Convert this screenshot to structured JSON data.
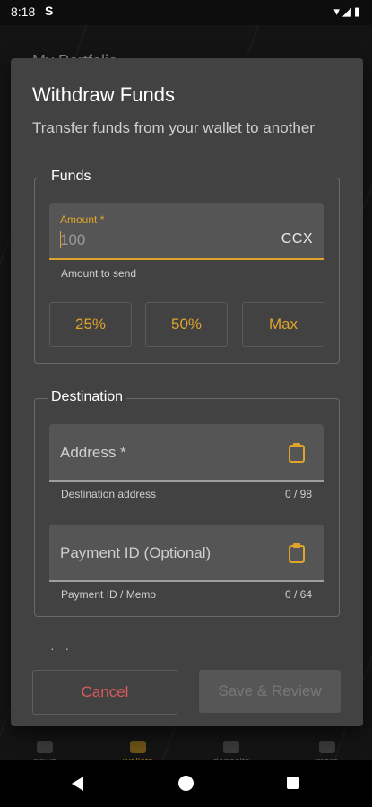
{
  "status_bar": {
    "time": "8:18",
    "app_icon": "S"
  },
  "background": {
    "title": "My Portfolio",
    "nav": [
      {
        "label": "news",
        "icon": "news-icon"
      },
      {
        "label": "wallets",
        "icon": "wallet-icon"
      },
      {
        "label": "deposits",
        "icon": "deposits-icon"
      },
      {
        "label": "more",
        "icon": "more-icon"
      }
    ]
  },
  "dialog": {
    "title": "Withdraw Funds",
    "subtitle": "Transfer funds from your wallet to another",
    "funds": {
      "legend": "Funds",
      "amount": {
        "label": "Amount *",
        "placeholder": "100",
        "suffix": "CCX",
        "helper": "Amount to send"
      },
      "quick": [
        "25%",
        "50%",
        "Max"
      ]
    },
    "destination": {
      "legend": "Destination",
      "address": {
        "label": "Address *",
        "helper": "Destination address",
        "counter": "0 / 98"
      },
      "payment_id": {
        "label": "Payment ID (Optional)",
        "helper": "Payment ID / Memo",
        "counter": "0 / 64"
      }
    },
    "cancel_label": "Cancel",
    "save_label": "Save & Review"
  },
  "colors": {
    "accent": "#e0a42c",
    "danger": "#d85a5a",
    "dialog_bg": "#424242"
  }
}
